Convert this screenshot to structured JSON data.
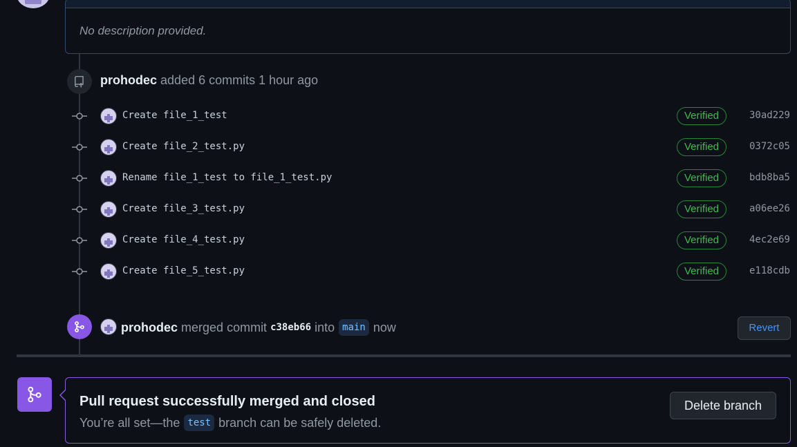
{
  "description": {
    "text": "No description provided."
  },
  "push_event": {
    "author": "prohodec",
    "action": "added 6 commits 1 hour ago"
  },
  "commits": [
    {
      "message": "Create file_1_test",
      "badge": "Verified",
      "sha": "30ad229"
    },
    {
      "message": "Create file_2_test.py",
      "badge": "Verified",
      "sha": "0372c05"
    },
    {
      "message": "Rename file_1_test to file_1_test.py",
      "badge": "Verified",
      "sha": "bdb8ba5"
    },
    {
      "message": "Create file_3_test.py",
      "badge": "Verified",
      "sha": "a06ee26"
    },
    {
      "message": "Create file_4_test.py",
      "badge": "Verified",
      "sha": "4ec2e69"
    },
    {
      "message": "Create file_5_test.py",
      "badge": "Verified",
      "sha": "e118cdb"
    }
  ],
  "merge_event": {
    "author": "prohodec",
    "action": "merged commit",
    "commit_sha": "c38eb66",
    "into": "into",
    "branch": "main",
    "time": "now",
    "revert_label": "Revert"
  },
  "merged_box": {
    "title": "Pull request successfully merged and closed",
    "sub_prefix": "You’re all set—the",
    "branch": "test",
    "sub_suffix": "branch can be safely deleted.",
    "delete_label": "Delete branch"
  },
  "colors": {
    "background": "#0d1117",
    "merged_purple": "#8957e5",
    "verified_green": "#3fb950",
    "link_blue": "#4493f8"
  },
  "icons": {
    "push": "repo-push-icon",
    "commit": "git-commit-icon",
    "merge": "git-merge-icon"
  }
}
